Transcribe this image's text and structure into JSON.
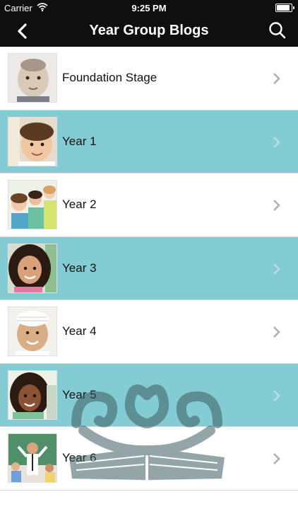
{
  "status_bar": {
    "carrier": "Carrier",
    "time": "9:25 PM",
    "battery_level": 1.0
  },
  "nav": {
    "title": "Year Group Blogs",
    "back_icon": "chevron-left-icon",
    "search_icon": "search-icon"
  },
  "rows": [
    {
      "label": "Foundation Stage",
      "highlighted": false
    },
    {
      "label": "Year 1",
      "highlighted": true
    },
    {
      "label": "Year 2",
      "highlighted": false
    },
    {
      "label": "Year 3",
      "highlighted": true
    },
    {
      "label": "Year 4",
      "highlighted": false
    },
    {
      "label": "Year 5",
      "highlighted": true
    },
    {
      "label": "Year 6",
      "highlighted": false
    }
  ],
  "colors": {
    "nav_bg": "#0f0f0f",
    "highlight_row": "#83ccd3",
    "watermark": "#3e5d61"
  }
}
